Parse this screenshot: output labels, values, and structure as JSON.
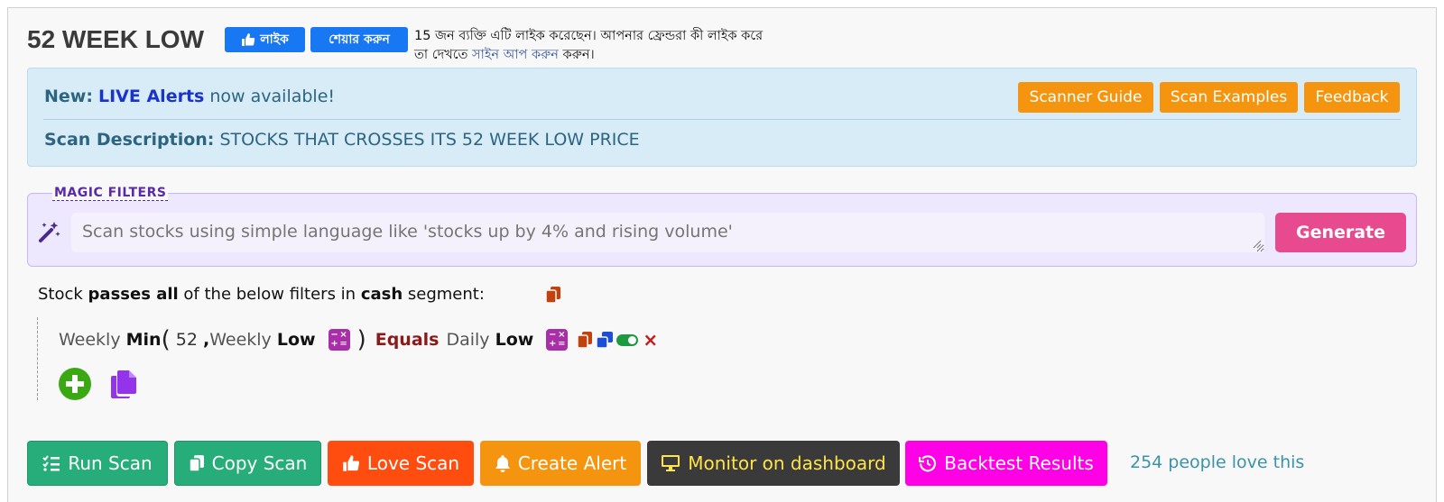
{
  "header": {
    "title": "52 WEEK LOW",
    "fb_like_label": "লাইক",
    "fb_share_label": "শেয়ার করুন",
    "fb_text_before": "15 জন ব্যক্তি এটি লাইক করেছেন। আপনার ফ্রেন্ডরা কী লাইক করে তা দেখতে ",
    "fb_text_link": "সাইন আপ করুন",
    "fb_text_after": " করুন।"
  },
  "info": {
    "new_prefix": "New:",
    "new_live": "LIVE Alerts",
    "new_suffix": " now available!",
    "desc_label": "Scan Description:",
    "desc_value": "STOCKS THAT CROSSES ITS 52 WEEK LOW PRICE",
    "buttons": {
      "guide": "Scanner Guide",
      "examples": "Scan Examples",
      "feedback": "Feedback"
    }
  },
  "magic": {
    "legend": "MAGIC FILTERS",
    "placeholder": "Scan stocks using simple language like 'stocks up by 4% and rising volume'",
    "generate": "Generate"
  },
  "filters": {
    "stmt_1": "Stock ",
    "stmt_passes": "passes all",
    "stmt_2": "  of the below filters in ",
    "stmt_cash": "cash",
    "stmt_3": "  segment:",
    "rule": {
      "t1": "Weekly ",
      "t2": "Min",
      "t3": "(",
      "t4": " 52 ",
      "t5": ",",
      "t6": "Weekly ",
      "t7": "Low",
      "t8": ")",
      "t9": "Equals",
      "t10": "Daily ",
      "t11": "Low",
      "remove": "×"
    }
  },
  "actions": {
    "run": "Run Scan",
    "copy": "Copy Scan",
    "love": "Love Scan",
    "alert": "Create Alert",
    "monitor": "Monitor on dashboard",
    "backtest": "Backtest Results",
    "love_count": "254 people love this"
  }
}
